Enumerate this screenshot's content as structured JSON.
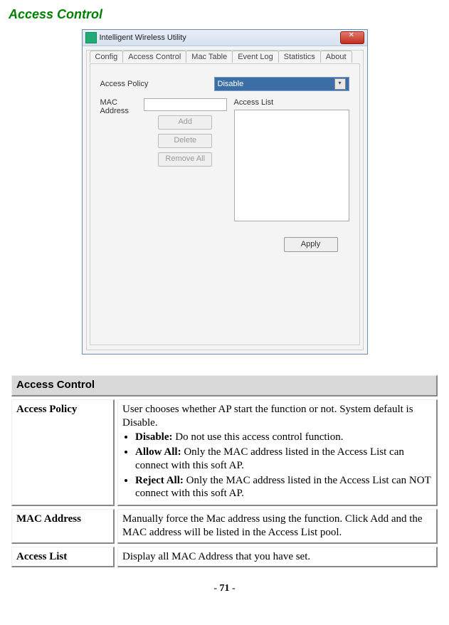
{
  "page": {
    "heading": "Access Control",
    "page_number_prefix": "- ",
    "page_number": "71",
    "page_number_suffix": " -"
  },
  "screenshot": {
    "window_title": "Intelligent Wireless Utility",
    "tabs": [
      "Config",
      "Access Control",
      "Mac Table",
      "Event Log",
      "Statistics",
      "About"
    ],
    "labels": {
      "access_policy": "Access Policy",
      "mac_address": "MAC Address",
      "access_list": "Access List"
    },
    "dropdown_value": "Disable",
    "buttons": {
      "add": "Add",
      "delete": "Delete",
      "remove_all": "Remove All",
      "apply": "Apply"
    }
  },
  "table": {
    "header": "Access Control",
    "rows": {
      "r1": {
        "key": "Access Policy",
        "intro": "User chooses whether AP start the function or not. System default is Disable.",
        "b1_label": "Disable:",
        "b1_text": " Do not use this access control function.",
        "b2_label": "Allow All:",
        "b2_text": " Only the MAC address listed in the Access List can connect with this soft AP.",
        "b3_label": "Reject All:",
        "b3_text": " Only the MAC address listed in the Access List can NOT connect with this soft AP."
      },
      "r2": {
        "key": "MAC Address",
        "text": "Manually force the Mac address using the function. Click Add and the MAC address will be listed in the Access List pool."
      },
      "r3": {
        "key": "Access List",
        "text": "Display all MAC Address that you have set."
      }
    }
  }
}
